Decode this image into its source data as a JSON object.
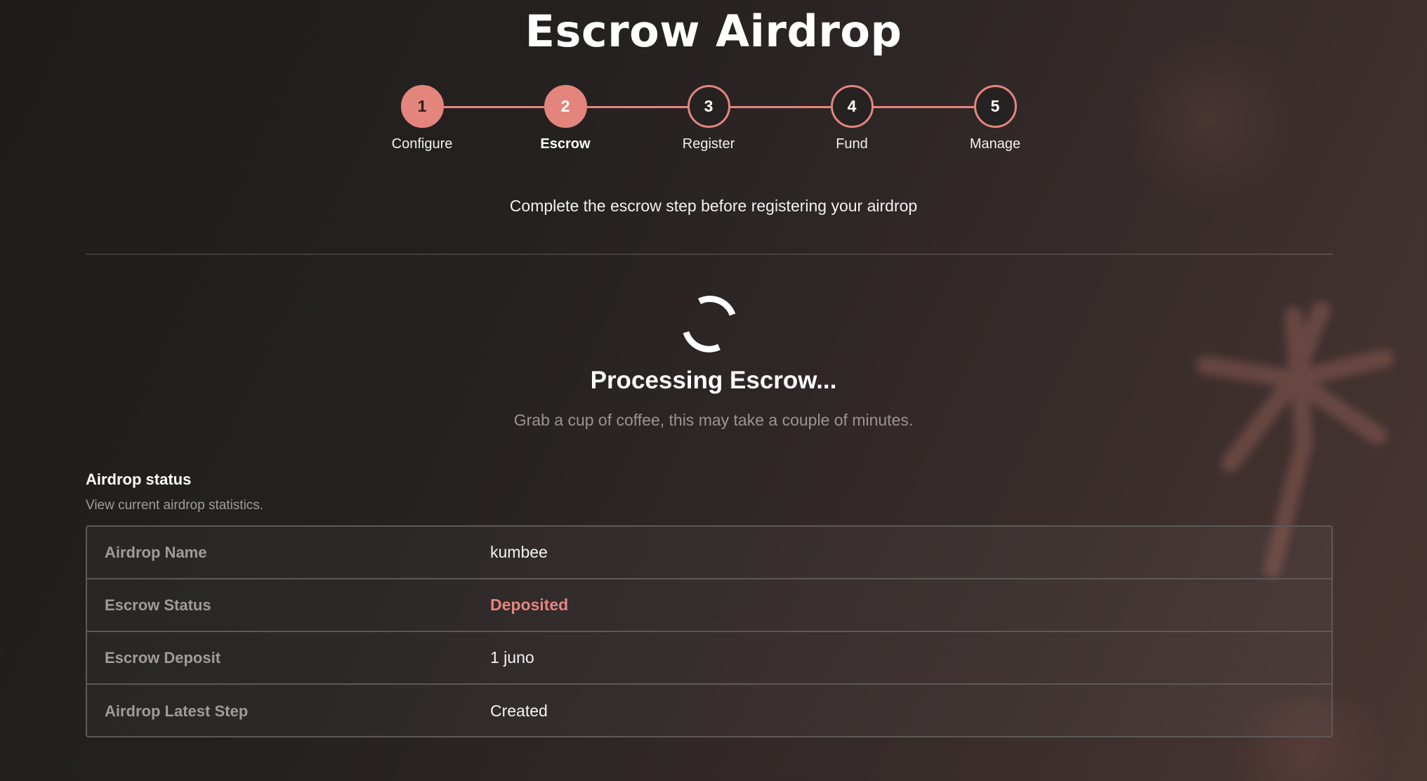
{
  "page": {
    "title": "Escrow Airdrop",
    "subtitle": "Complete the escrow step before registering your airdrop"
  },
  "stepper": {
    "steps": [
      {
        "number": "1",
        "label": "Configure",
        "state": "done"
      },
      {
        "number": "2",
        "label": "Escrow",
        "state": "active"
      },
      {
        "number": "3",
        "label": "Register",
        "state": "pending"
      },
      {
        "number": "4",
        "label": "Fund",
        "state": "pending"
      },
      {
        "number": "5",
        "label": "Manage",
        "state": "pending"
      }
    ]
  },
  "processing": {
    "title": "Processing Escrow...",
    "subtitle": "Grab a cup of coffee, this may take a couple of minutes."
  },
  "status": {
    "title": "Airdrop status",
    "subtitle": "View current airdrop statistics.",
    "rows": [
      {
        "key": "Airdrop Name",
        "value": "kumbee"
      },
      {
        "key": "Escrow Status",
        "value": "Deposited"
      },
      {
        "key": "Escrow Deposit",
        "value": "1 juno"
      },
      {
        "key": "Airdrop Latest Step",
        "value": "Created"
      }
    ]
  },
  "colors": {
    "accent": "#e4857d",
    "background": "#241f1f",
    "border": "#5e5959",
    "muted_text": "#a19b9a"
  }
}
